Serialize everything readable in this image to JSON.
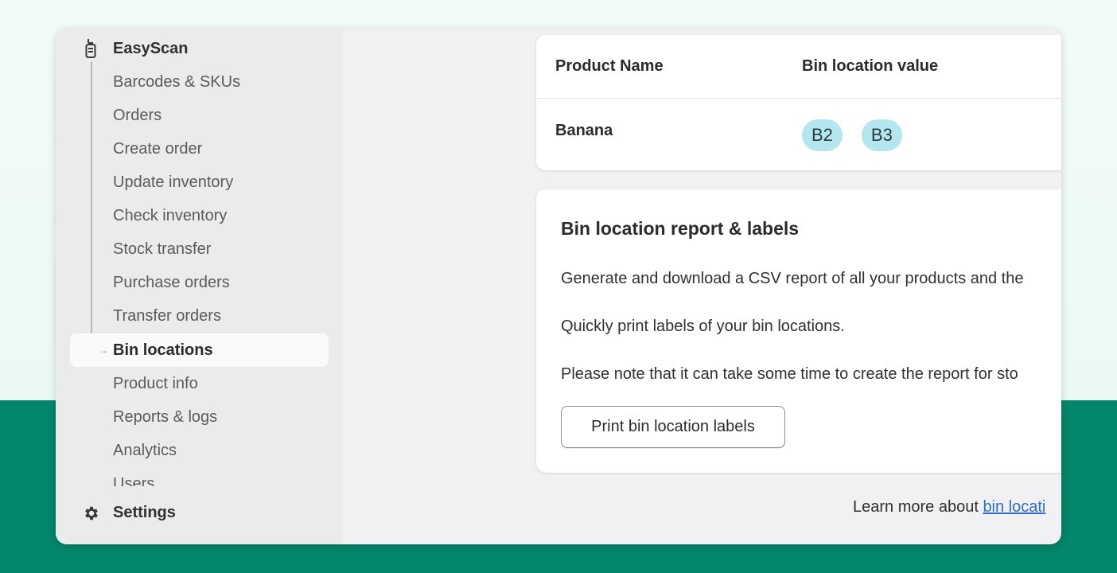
{
  "sidebar": {
    "app_name": "EasyScan",
    "items": [
      {
        "label": "Barcodes & SKUs"
      },
      {
        "label": "Orders"
      },
      {
        "label": "Create order"
      },
      {
        "label": "Update inventory"
      },
      {
        "label": "Check inventory"
      },
      {
        "label": "Stock transfer"
      },
      {
        "label": "Purchase orders"
      },
      {
        "label": "Transfer orders"
      },
      {
        "label": "Bin locations",
        "active": true
      },
      {
        "label": "Product info"
      },
      {
        "label": "Reports & logs"
      },
      {
        "label": "Analytics"
      },
      {
        "label": "Users"
      }
    ],
    "settings_label": "Settings"
  },
  "table": {
    "headers": [
      "Product Name",
      "Bin location value"
    ],
    "rows": [
      {
        "product": "Banana",
        "bins": [
          "B2",
          "B3"
        ]
      }
    ]
  },
  "report_card": {
    "title": "Bin location report & labels",
    "paragraphs": [
      "Generate and download a CSV report of all your products and the",
      "Quickly print labels of your bin locations.",
      "Please note that it can take some time to create the report for sto"
    ],
    "print_button_label": "Print bin location labels"
  },
  "footer": {
    "learn_more_text": "Learn more about ",
    "learn_more_link": "bin locati"
  },
  "colors": {
    "brand_green": "#04866a",
    "badge_bg": "#b3e6ee",
    "link": "#2c6ecb"
  }
}
